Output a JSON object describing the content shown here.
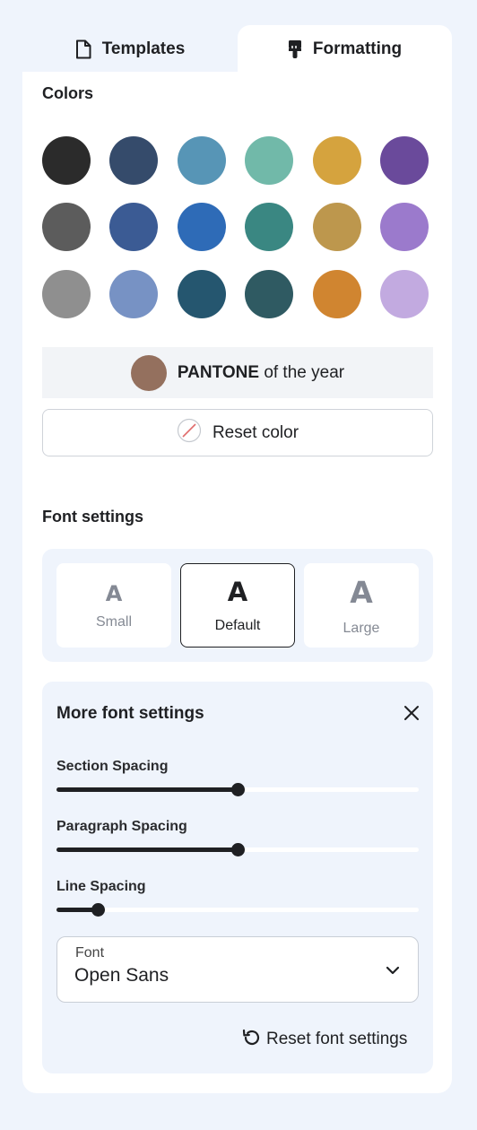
{
  "tabs": [
    {
      "label": "Templates",
      "icon": "document-icon",
      "active": false
    },
    {
      "label": "Formatting",
      "icon": "paint-brush-icon",
      "active": true
    }
  ],
  "colors": {
    "title": "Colors",
    "swatches": [
      "#2b2b2b",
      "#354b6b",
      "#5795b6",
      "#71b9a9",
      "#d5a33e",
      "#6a4a9b",
      "#5c5c5c",
      "#3b5b94",
      "#2e6bb7",
      "#3a8782",
      "#bd974d",
      "#9b7acc",
      "#8f8f8f",
      "#7792c4",
      "#25566f",
      "#2f5a62",
      "#d08530",
      "#c2aae0"
    ],
    "pantone": {
      "color": "#94705e",
      "brand": "PANTONE",
      "suffix": "of the year"
    },
    "reset_label": "Reset color"
  },
  "font_settings": {
    "title": "Font settings",
    "sizes": [
      {
        "letter": "A",
        "label": "Small",
        "active": false
      },
      {
        "letter": "A",
        "label": "Default",
        "active": true
      },
      {
        "letter": "A",
        "label": "Large",
        "active": false
      }
    ]
  },
  "more_font_settings": {
    "title": "More font settings",
    "sliders": [
      {
        "label": "Section Spacing",
        "value": 0.5
      },
      {
        "label": "Paragraph Spacing",
        "value": 0.5
      },
      {
        "label": "Line Spacing",
        "value": 0.115
      }
    ],
    "font": {
      "label": "Font",
      "value": "Open Sans"
    },
    "reset_label": "Reset font settings"
  }
}
